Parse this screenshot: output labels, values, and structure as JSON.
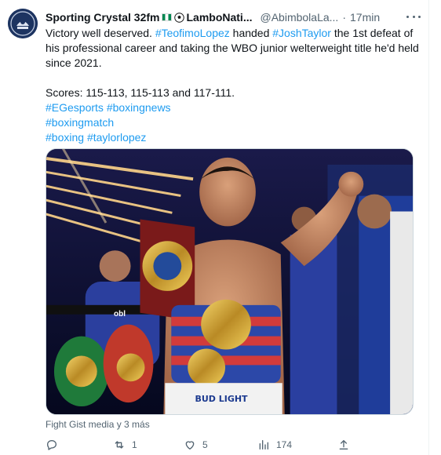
{
  "author": {
    "display_name": "Sporting Crystal 32fm",
    "display_name_suffix": "LamboNati...",
    "handle": "@AbimbolaLa...",
    "separator": "·",
    "time": "17min"
  },
  "body": {
    "line1_prefix": "Victory well deserved. ",
    "mention1": "#TeofimoLopez",
    "line1_mid": " handed ",
    "mention2": "#JoshTaylor",
    "line1_suffix": " the 1st defeat of his professional career and taking the WBO junior welterweight title he'd held since 2021.",
    "scores": " Scores: 115-113, 115-113 and 117-111.",
    "hashtags_line1_a": "#EGesports",
    "hashtags_line1_b": "#boxingnews",
    "hashtags_line2": "#boxingmatch",
    "hashtags_line3_a": "#boxing",
    "hashtags_line3_b": "#taylorlopez"
  },
  "media": {
    "caption": "Fight Gist media y 3 más",
    "belt_text": "BUD LIGHT",
    "banner_text": "obl"
  },
  "actions": {
    "replies": "",
    "retweets": "1",
    "likes": "5",
    "views": "174"
  },
  "colors": {
    "link": "#1d9bf0",
    "secondary": "#536471",
    "text": "#0f1419"
  }
}
